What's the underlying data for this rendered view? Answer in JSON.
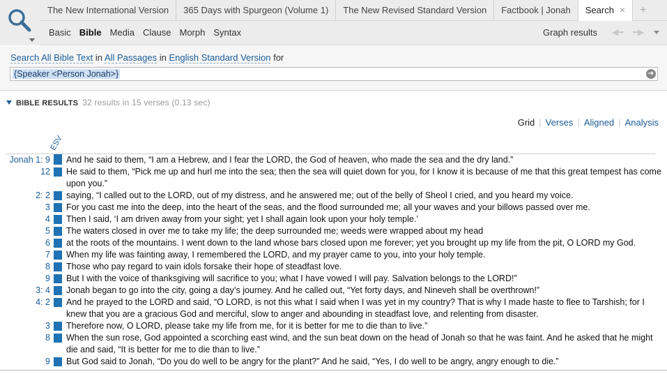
{
  "tabs": [
    {
      "label": "The New International Version"
    },
    {
      "label": "365 Days with Spurgeon (Volume 1)"
    },
    {
      "label": "The New Revised Standard Version"
    },
    {
      "label": "Factbook | Jonah"
    },
    {
      "label": "Search"
    }
  ],
  "tab_add": "+",
  "tab_close": "×",
  "subtabs": [
    "Basic",
    "Bible",
    "Media",
    "Clause",
    "Morph",
    "Syntax"
  ],
  "graph_results": "Graph results",
  "search_line": {
    "prefix": "Search All Bible Text",
    "in1": "in",
    "passages": "All Passages",
    "in2": "in",
    "version": "English Standard Version",
    "for": "for"
  },
  "query": "{Speaker <Person Jonah>}",
  "results_header": {
    "label": "BIBLE RESULTS",
    "count": "32 results in 15 verses (0.13 sec)"
  },
  "views": [
    "Grid",
    "Verses",
    "Aligned",
    "Analysis"
  ],
  "column_label": "ESV",
  "verses": [
    {
      "ref": "Jonah 1: 9",
      "text": "And he said to them, “I am a Hebrew, and I fear the LORD, the God of heaven, who made the sea and the dry land.”"
    },
    {
      "ref": "12",
      "text": "He said to them, “Pick me up and hurl me into the sea; then the sea will quiet down for you, for I know it is because of me that this great tempest has come upon you.”"
    },
    {
      "ref": "2: 2",
      "text": "saying, “I called out to the LORD, out of my distress, and he answered me; out of the belly of Sheol I cried, and you heard my voice."
    },
    {
      "ref": "3",
      "text": "For you cast me into the deep, into the heart of the seas, and the flood surrounded me; all your waves and your billows passed over me."
    },
    {
      "ref": "4",
      "text": "Then I said, ‘I am driven away from your sight; yet I shall again look upon your holy temple.’"
    },
    {
      "ref": "5",
      "text": "The waters closed in over me to take my life; the deep surrounded me; weeds were wrapped about my head"
    },
    {
      "ref": "6",
      "text": "at the roots of the mountains. I went down to the land whose bars closed upon me forever; yet you brought up my life from the pit, O LORD my God."
    },
    {
      "ref": "7",
      "text": "When my life was fainting away, I remembered the LORD, and my prayer came to you, into your holy temple."
    },
    {
      "ref": "8",
      "text": "Those who pay regard to vain idols forsake their hope of steadfast love."
    },
    {
      "ref": "9",
      "text": "But I with the voice of thanksgiving will sacrifice to you; what I have vowed I will pay. Salvation belongs to the LORD!”"
    },
    {
      "ref": "3: 4",
      "text": "Jonah began to go into the city, going a day’s journey. And he called out, “Yet forty days, and Nineveh shall be overthrown!”"
    },
    {
      "ref": "4: 2",
      "text": "And he prayed to the LORD and said, “O LORD, is not this what I said when I was yet in my country? That is why I made haste to flee to Tarshish; for I knew that you are a gracious God and merciful, slow to anger and abounding in steadfast love, and relenting from disaster."
    },
    {
      "ref": "3",
      "text": "Therefore now, O LORD, please take my life from me, for it is better for me to die than to live.”"
    },
    {
      "ref": "8",
      "text": "When the sun rose, God appointed a scorching east wind, and the sun beat down on the head of Jonah so that he was faint. And he asked that he might die and said, “It is better for me to die than to live.”"
    },
    {
      "ref": "9",
      "text": "But God said to Jonah, “Do you do well to be angry for the plant?” And he said, “Yes, I do well to be angry, angry enough to die.”"
    }
  ],
  "colors": {
    "accent": "#1c5d98",
    "bar": "#1f73b4",
    "highlight": "#fbe2ae"
  }
}
